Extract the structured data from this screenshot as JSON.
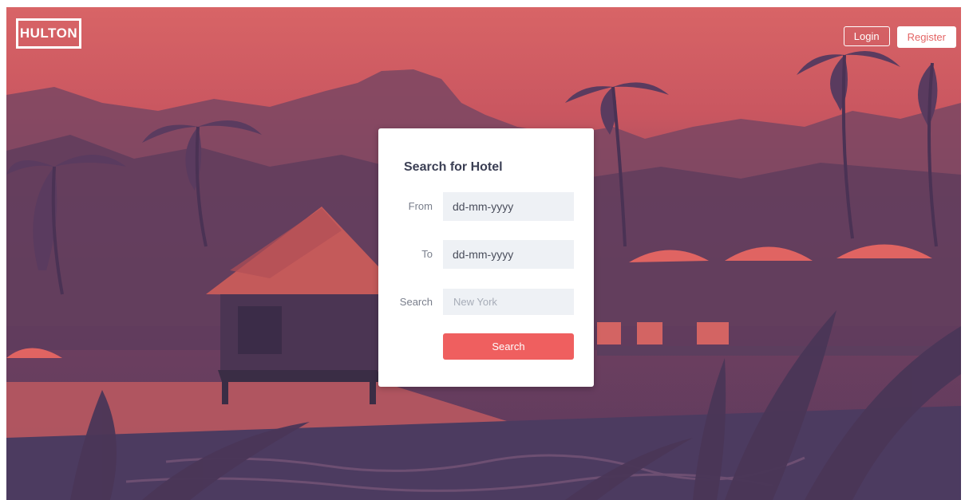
{
  "header": {
    "logo": "HULTON",
    "login_label": "Login",
    "register_label": "Register"
  },
  "search_card": {
    "title": "Search for Hotel",
    "from": {
      "label": "From",
      "placeholder": "dd-mm-yyyy"
    },
    "to": {
      "label": "To",
      "placeholder": "dd-mm-yyyy"
    },
    "query": {
      "label": "Search",
      "placeholder": "New York"
    },
    "submit_label": "Search"
  },
  "theme": {
    "accent": "#ef5f5f",
    "overlay_top": "#d86466",
    "overlay_bottom": "#5a3a5e"
  }
}
